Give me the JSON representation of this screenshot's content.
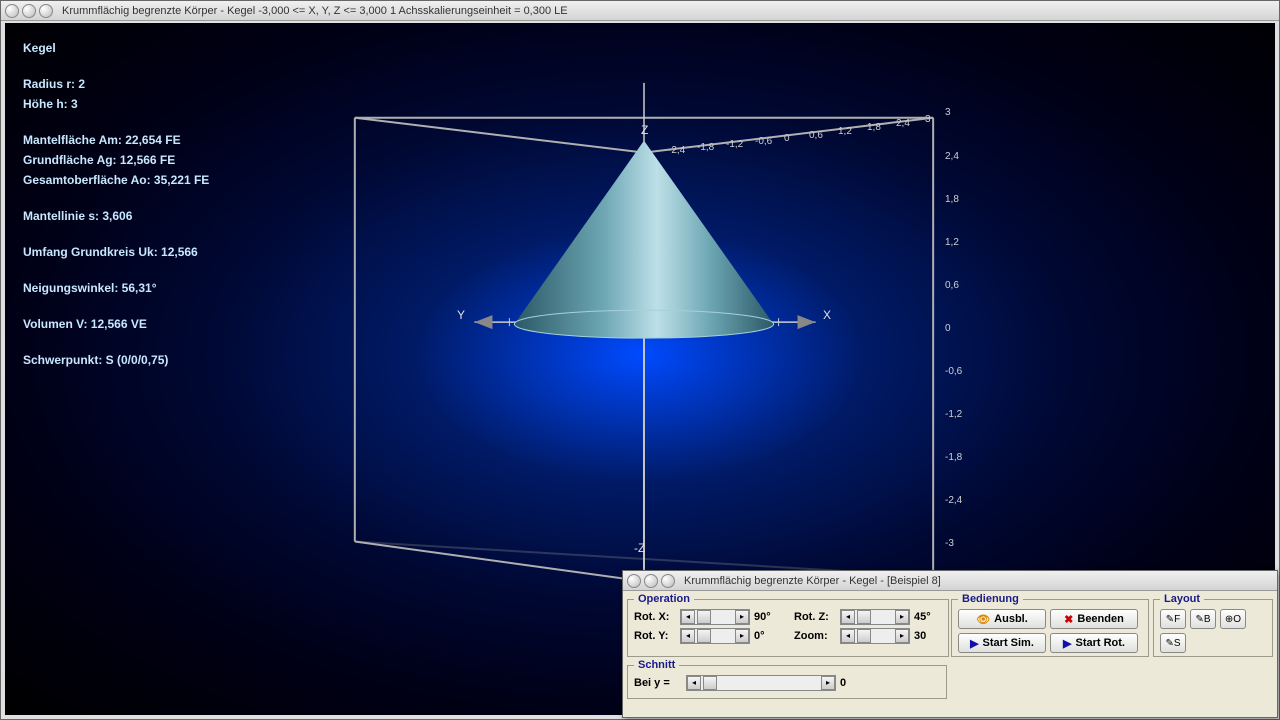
{
  "main_window": {
    "title": "Krummflächig begrenzte Körper - Kegel   -3,000 <= X, Y, Z <= 3,000    1 Achsskalierungseinheit = 0,300 LE"
  },
  "info": {
    "heading": "Kegel",
    "radius": "Radius r:  2",
    "height": "Höhe h:  3",
    "mantel": "Mantelfläche Am:  22,654 FE",
    "grund": "Grundfläche Ag:  12,566 FE",
    "ober": "Gesamtoberfläche Ao:  35,221 FE",
    "mantellinie": "Mantellinie s:  3,606",
    "umfang": "Umfang Grundkreis Uk:  12,566",
    "neigung": "Neigungswinkel:  56,31°",
    "volumen": "Volumen V:  12,566 VE",
    "schwerpunkt": "Schwerpunkt:  S (0/0/0,75)"
  },
  "axes": {
    "xlabel": "X",
    "ylabel": "Y",
    "zlabel": "Z",
    "zneg": "-Z",
    "right_ticks": [
      "3",
      "2,4",
      "1,8",
      "1,2",
      "0,6",
      "0",
      "-0,6",
      "-1,2",
      "-1,8",
      "-2,4",
      "-3"
    ],
    "top_ticks": [
      "-2,4",
      "-1,8",
      "-1,2",
      "-0,6",
      "0",
      "0,6",
      "1,2",
      "1,8",
      "2,4",
      "3"
    ]
  },
  "control_window": {
    "title": "Krummflächig begrenzte Körper - Kegel - [Beispiel 8]"
  },
  "operation": {
    "legend": "Operation",
    "rotx_label": "Rot. X:",
    "rotx_val": "90°",
    "roty_label": "Rot. Y:",
    "roty_val": "0°",
    "rotz_label": "Rot. Z:",
    "rotz_val": "45°",
    "zoom_label": "Zoom:",
    "zoom_val": "30"
  },
  "bedienung": {
    "legend": "Bedienung",
    "ausbl": "Ausbl.",
    "beenden": "Beenden",
    "startsim": "Start Sim.",
    "startrot": "Start Rot."
  },
  "layout": {
    "legend": "Layout",
    "f": "F",
    "b": "B",
    "o": "O",
    "s": "S"
  },
  "schnitt": {
    "legend": "Schnitt",
    "bei_label": "Bei y =",
    "val": "0"
  }
}
